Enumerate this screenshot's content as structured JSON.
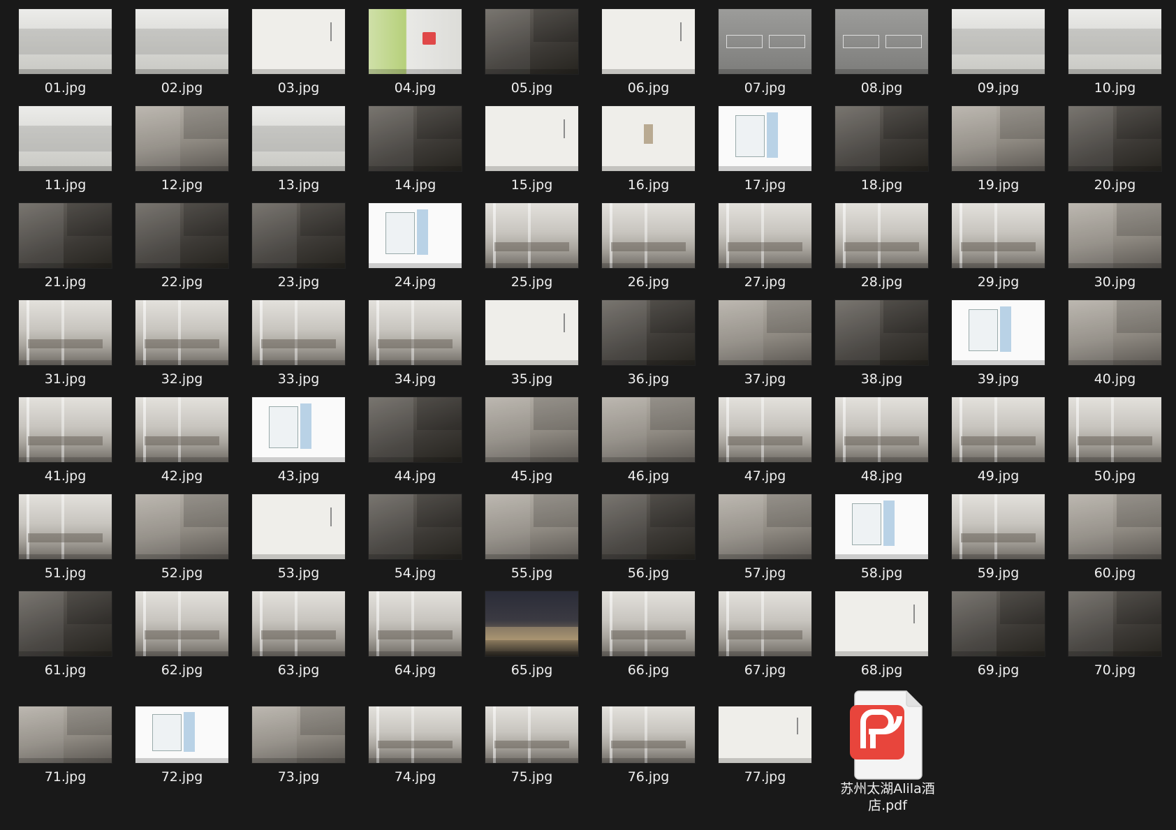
{
  "files": [
    {
      "name": "01.jpg",
      "tone": "light"
    },
    {
      "name": "02.jpg",
      "tone": "light"
    },
    {
      "name": "03.jpg",
      "tone": "paper"
    },
    {
      "name": "04.jpg",
      "tone": "map"
    },
    {
      "name": "05.jpg",
      "tone": "dark"
    },
    {
      "name": "06.jpg",
      "tone": "paper"
    },
    {
      "name": "07.jpg",
      "tone": "grey"
    },
    {
      "name": "08.jpg",
      "tone": "grey"
    },
    {
      "name": "09.jpg",
      "tone": "light"
    },
    {
      "name": "10.jpg",
      "tone": "light"
    },
    {
      "name": "11.jpg",
      "tone": "light"
    },
    {
      "name": "12.jpg",
      "tone": "mid"
    },
    {
      "name": "13.jpg",
      "tone": "light"
    },
    {
      "name": "14.jpg",
      "tone": "dark"
    },
    {
      "name": "15.jpg",
      "tone": "paper"
    },
    {
      "name": "16.jpg",
      "tone": "paper"
    },
    {
      "name": "17.jpg",
      "tone": "plan"
    },
    {
      "name": "18.jpg",
      "tone": "dark"
    },
    {
      "name": "19.jpg",
      "tone": "mid"
    },
    {
      "name": "20.jpg",
      "tone": "dark"
    },
    {
      "name": "21.jpg",
      "tone": "dark"
    },
    {
      "name": "22.jpg",
      "tone": "dark"
    },
    {
      "name": "23.jpg",
      "tone": "dark"
    },
    {
      "name": "24.jpg",
      "tone": "plan"
    },
    {
      "name": "25.jpg",
      "tone": "interior"
    },
    {
      "name": "26.jpg",
      "tone": "interior"
    },
    {
      "name": "27.jpg",
      "tone": "interior"
    },
    {
      "name": "28.jpg",
      "tone": "interior"
    },
    {
      "name": "29.jpg",
      "tone": "interior"
    },
    {
      "name": "30.jpg",
      "tone": "mid"
    },
    {
      "name": "31.jpg",
      "tone": "interior"
    },
    {
      "name": "32.jpg",
      "tone": "interior"
    },
    {
      "name": "33.jpg",
      "tone": "interior"
    },
    {
      "name": "34.jpg",
      "tone": "interior"
    },
    {
      "name": "35.jpg",
      "tone": "paper"
    },
    {
      "name": "36.jpg",
      "tone": "dark"
    },
    {
      "name": "37.jpg",
      "tone": "mid"
    },
    {
      "name": "38.jpg",
      "tone": "dark"
    },
    {
      "name": "39.jpg",
      "tone": "plan"
    },
    {
      "name": "40.jpg",
      "tone": "mid"
    },
    {
      "name": "41.jpg",
      "tone": "interior"
    },
    {
      "name": "42.jpg",
      "tone": "interior"
    },
    {
      "name": "43.jpg",
      "tone": "plan"
    },
    {
      "name": "44.jpg",
      "tone": "dark"
    },
    {
      "name": "45.jpg",
      "tone": "mid"
    },
    {
      "name": "46.jpg",
      "tone": "mid"
    },
    {
      "name": "47.jpg",
      "tone": "interior"
    },
    {
      "name": "48.jpg",
      "tone": "interior"
    },
    {
      "name": "49.jpg",
      "tone": "interior"
    },
    {
      "name": "50.jpg",
      "tone": "interior"
    },
    {
      "name": "51.jpg",
      "tone": "interior"
    },
    {
      "name": "52.jpg",
      "tone": "mid"
    },
    {
      "name": "53.jpg",
      "tone": "paper"
    },
    {
      "name": "54.jpg",
      "tone": "dark"
    },
    {
      "name": "55.jpg",
      "tone": "mid"
    },
    {
      "name": "56.jpg",
      "tone": "dark"
    },
    {
      "name": "57.jpg",
      "tone": "mid"
    },
    {
      "name": "58.jpg",
      "tone": "plan"
    },
    {
      "name": "59.jpg",
      "tone": "interior"
    },
    {
      "name": "60.jpg",
      "tone": "mid"
    },
    {
      "name": "61.jpg",
      "tone": "dark"
    },
    {
      "name": "62.jpg",
      "tone": "interior"
    },
    {
      "name": "63.jpg",
      "tone": "interior"
    },
    {
      "name": "64.jpg",
      "tone": "interior"
    },
    {
      "name": "65.jpg",
      "tone": "night"
    },
    {
      "name": "66.jpg",
      "tone": "interior"
    },
    {
      "name": "67.jpg",
      "tone": "interior"
    },
    {
      "name": "68.jpg",
      "tone": "paper"
    },
    {
      "name": "69.jpg",
      "tone": "dark"
    },
    {
      "name": "70.jpg",
      "tone": "dark"
    },
    {
      "name": "71.jpg",
      "tone": "mid"
    },
    {
      "name": "72.jpg",
      "tone": "plan"
    },
    {
      "name": "73.jpg",
      "tone": "mid"
    },
    {
      "name": "74.jpg",
      "tone": "interior"
    },
    {
      "name": "75.jpg",
      "tone": "interior"
    },
    {
      "name": "76.jpg",
      "tone": "interior"
    },
    {
      "name": "77.jpg",
      "tone": "paper"
    }
  ],
  "pdf": {
    "name": "苏州太湖Alila酒店.pdf",
    "icon": "wps-pdf-icon",
    "accent": "#e8453c"
  },
  "colors": {
    "background": "#191919",
    "label": "#f0f0f0"
  }
}
